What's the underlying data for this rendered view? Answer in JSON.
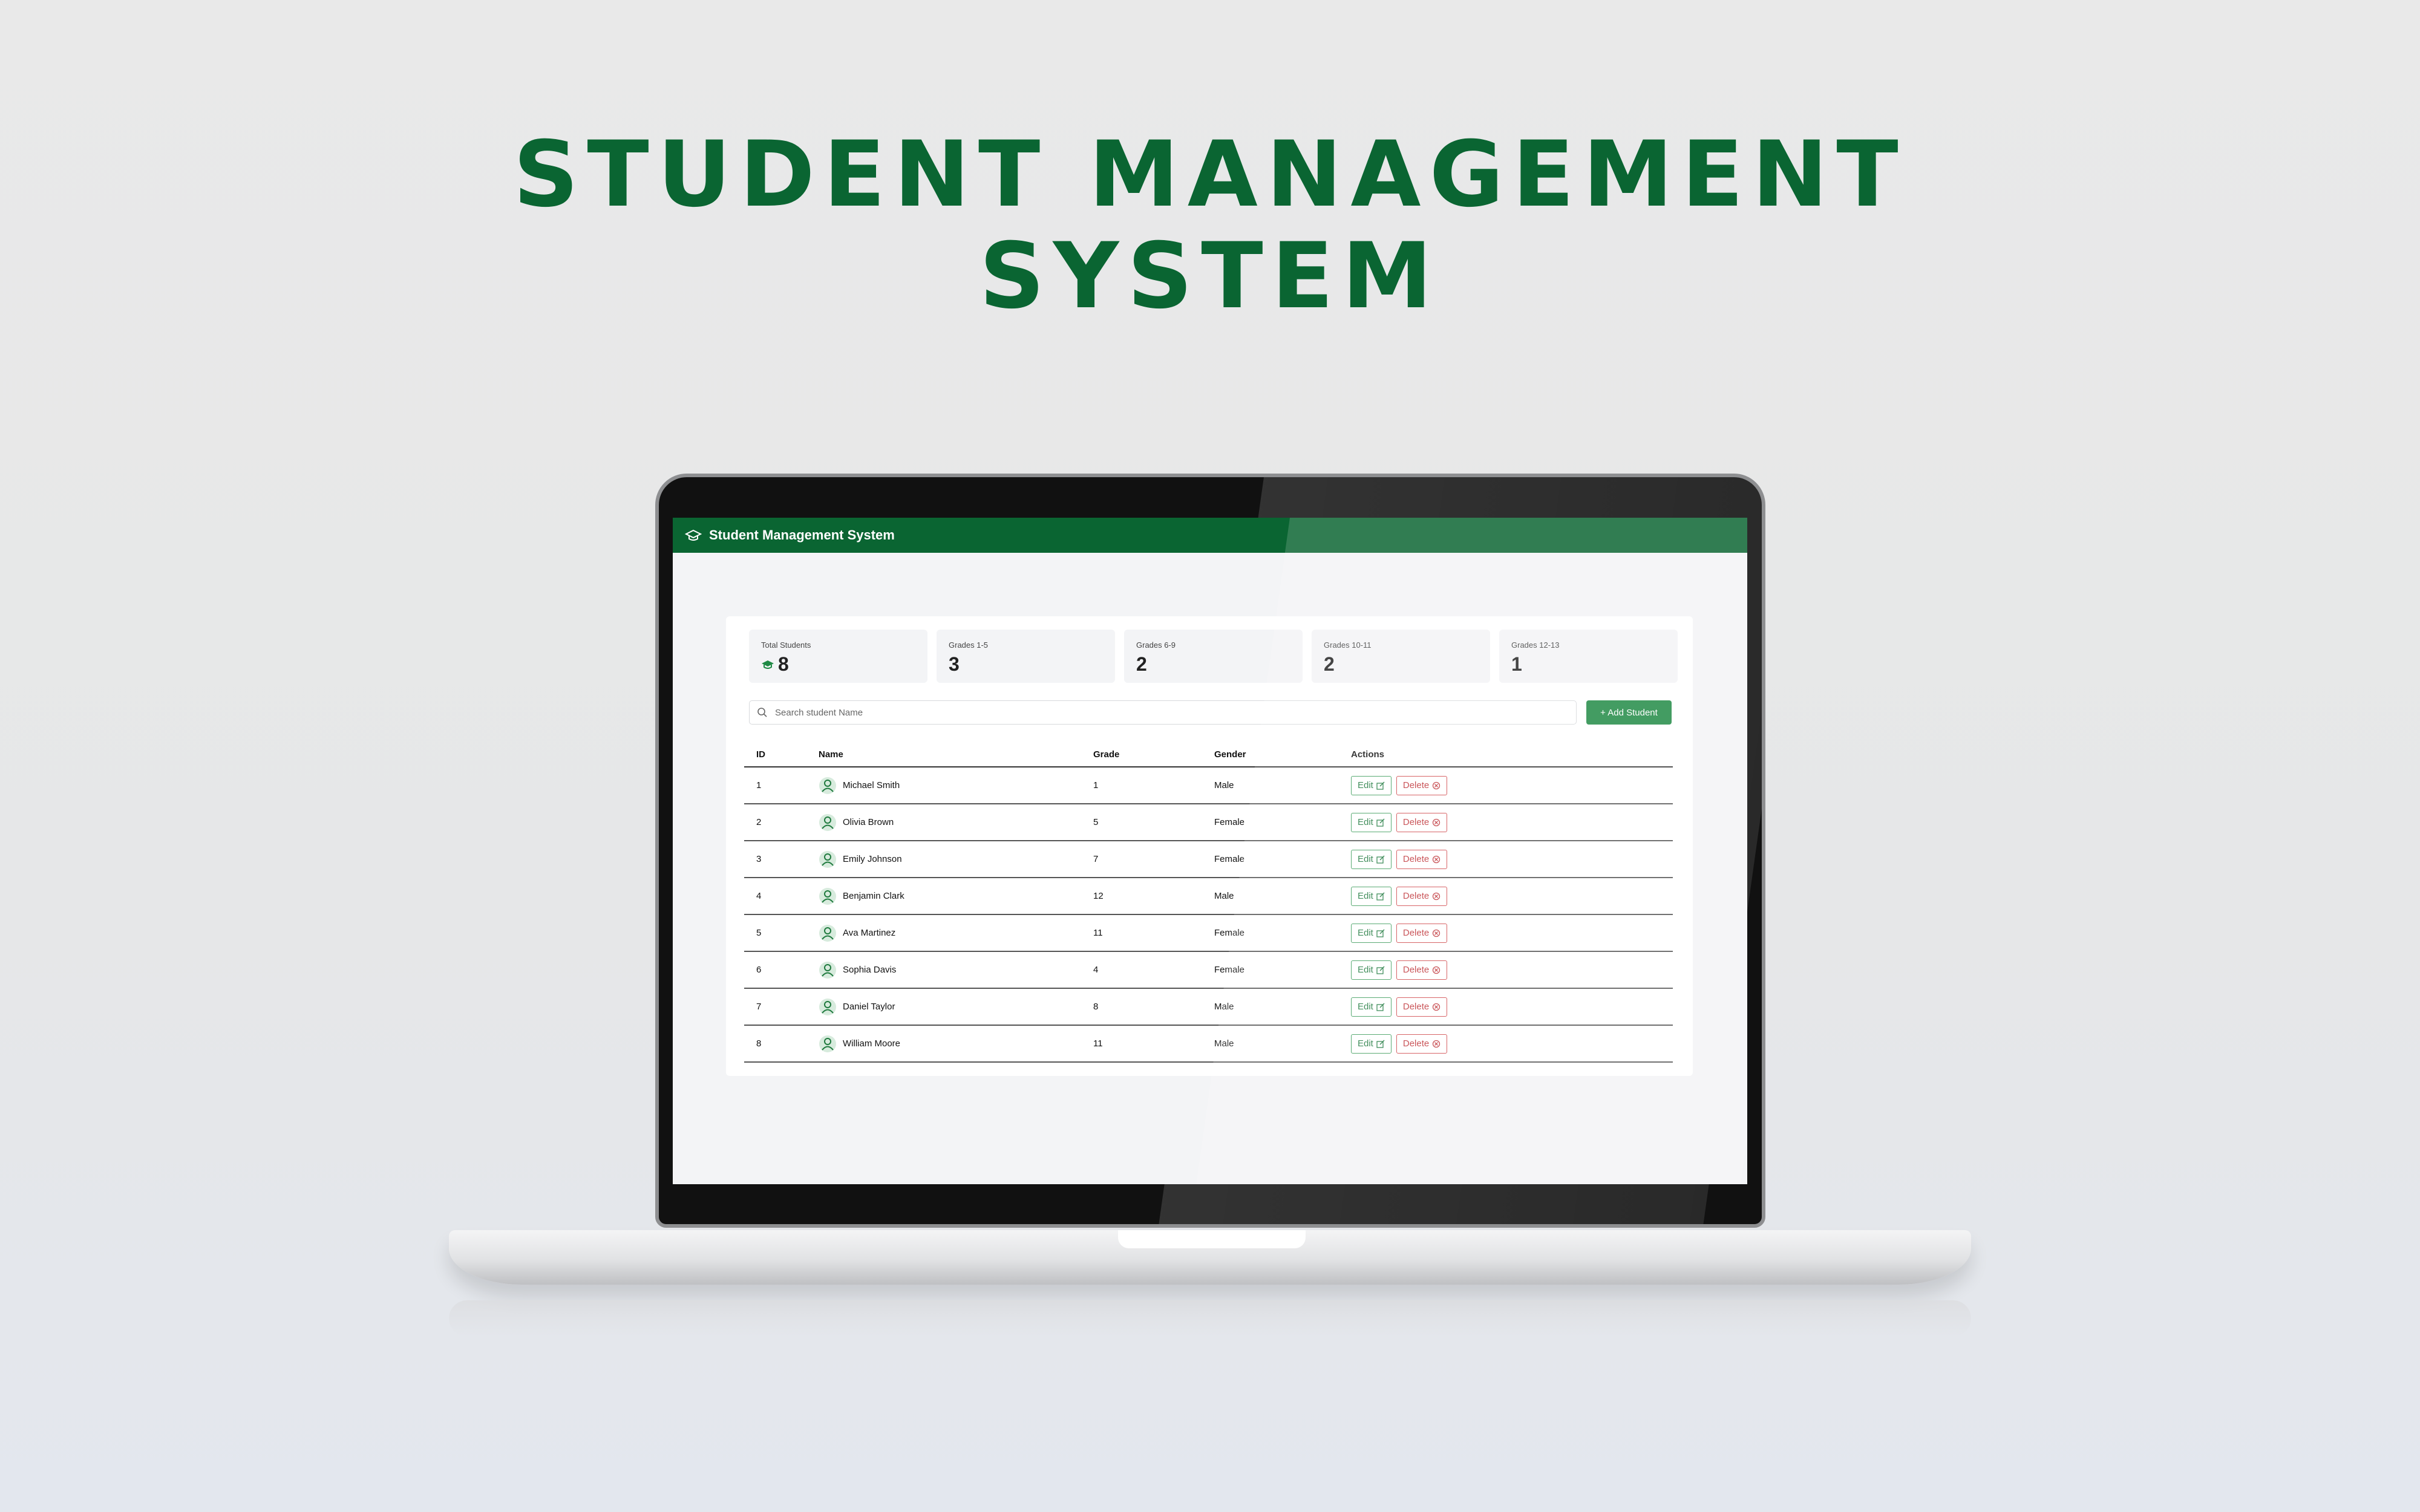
{
  "hero": {
    "title_line1": "STUDENT MANAGEMENT",
    "title_line2": "SYSTEM"
  },
  "app": {
    "title": "Student Management System",
    "brand_color": "#0a6532",
    "accent_color": "#1f8a45",
    "danger_color": "#c0363b"
  },
  "stats": [
    {
      "label": "Total Students",
      "value": "8",
      "icon": "graduation-cap-icon"
    },
    {
      "label": "Grades 1-5",
      "value": "3"
    },
    {
      "label": "Grades 6-9",
      "value": "2"
    },
    {
      "label": "Grades 10-11",
      "value": "2"
    },
    {
      "label": "Grades 12-13",
      "value": "1"
    }
  ],
  "search": {
    "placeholder": "Search student Name",
    "value": ""
  },
  "add_button": "+ Add Student",
  "table": {
    "headers": {
      "id": "ID",
      "name": "Name",
      "grade": "Grade",
      "gender": "Gender",
      "actions": "Actions"
    },
    "edit_label": "Edit",
    "delete_label": "Delete",
    "rows": [
      {
        "id": "1",
        "name": "Michael Smith",
        "grade": "1",
        "gender": "Male"
      },
      {
        "id": "2",
        "name": "Olivia Brown",
        "grade": "5",
        "gender": "Female"
      },
      {
        "id": "3",
        "name": "Emily Johnson",
        "grade": "7",
        "gender": "Female"
      },
      {
        "id": "4",
        "name": "Benjamin Clark",
        "grade": "12",
        "gender": "Male"
      },
      {
        "id": "5",
        "name": "Ava Martinez",
        "grade": "11",
        "gender": "Female"
      },
      {
        "id": "6",
        "name": "Sophia Davis",
        "grade": "4",
        "gender": "Female"
      },
      {
        "id": "7",
        "name": "Daniel Taylor",
        "grade": "8",
        "gender": "Male"
      },
      {
        "id": "8",
        "name": "William Moore",
        "grade": "11",
        "gender": "Male"
      }
    ]
  }
}
